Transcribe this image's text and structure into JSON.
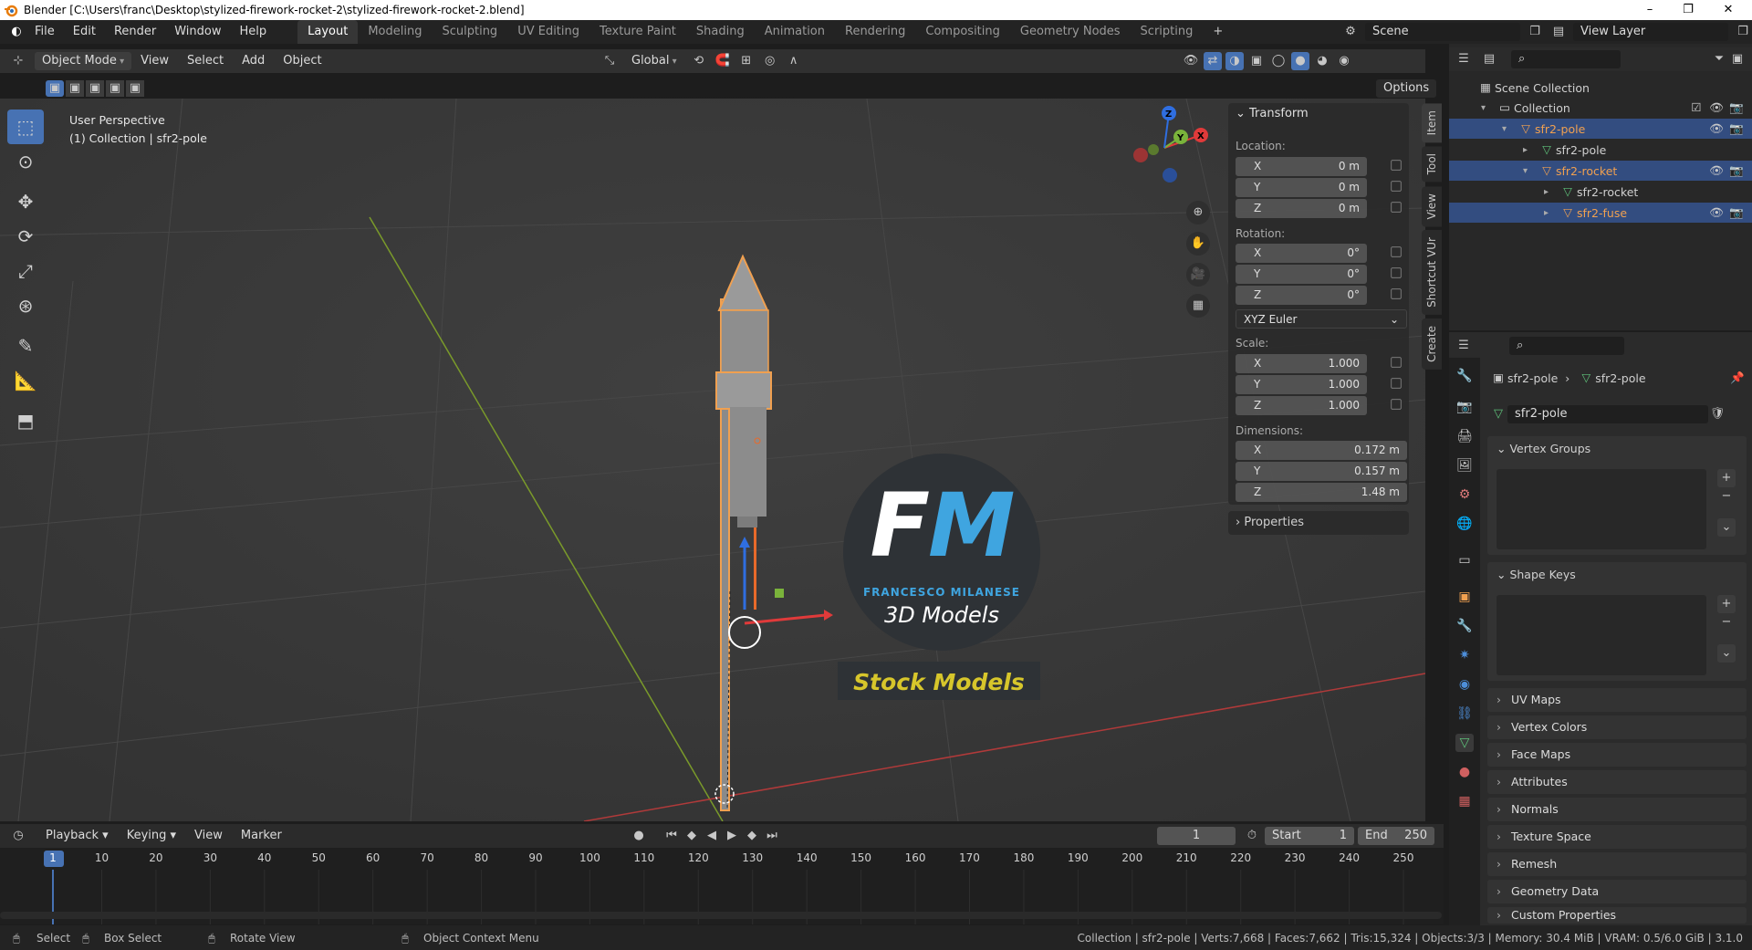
{
  "window": {
    "title": "Blender [C:\\Users\\franc\\Desktop\\stylized-firework-rocket-2\\stylized-firework-rocket-2.blend]",
    "minimize": "–",
    "maximize": "❐",
    "close": "✕"
  },
  "menu": [
    "File",
    "Edit",
    "Render",
    "Window",
    "Help"
  ],
  "workspaces": [
    "Layout",
    "Modeling",
    "Sculpting",
    "UV Editing",
    "Texture Paint",
    "Shading",
    "Animation",
    "Rendering",
    "Compositing",
    "Geometry Nodes",
    "Scripting"
  ],
  "active_workspace": "Layout",
  "add_workspace": "+",
  "scene_name": "Scene",
  "view_layer": "View Layer",
  "viewport_header": {
    "mode": "Object Mode",
    "view": "View",
    "select": "Select",
    "add": "Add",
    "object": "Object",
    "transform_orientation": "Global",
    "options": "Options"
  },
  "viewport_overlay": {
    "perspective": "User Perspective",
    "context": "(1) Collection | sfr2-pole"
  },
  "watermark": {
    "logo_letters": "FM",
    "author": "FRANCESCO MILANESE",
    "tagline": "3D Models",
    "stock": "Stock Models"
  },
  "gizmo_axes": [
    "X",
    "Y",
    "Z"
  ],
  "npanel": {
    "title": "Transform",
    "location_label": "Location:",
    "location": [
      {
        "axis": "X",
        "value": "0 m"
      },
      {
        "axis": "Y",
        "value": "0 m"
      },
      {
        "axis": "Z",
        "value": "0 m"
      }
    ],
    "rotation_label": "Rotation:",
    "rotation": [
      {
        "axis": "X",
        "value": "0°"
      },
      {
        "axis": "Y",
        "value": "0°"
      },
      {
        "axis": "Z",
        "value": "0°"
      }
    ],
    "rotation_mode": "XYZ Euler",
    "scale_label": "Scale:",
    "scale": [
      {
        "axis": "X",
        "value": "1.000"
      },
      {
        "axis": "Y",
        "value": "1.000"
      },
      {
        "axis": "Z",
        "value": "1.000"
      }
    ],
    "dimensions_label": "Dimensions:",
    "dimensions": [
      {
        "axis": "X",
        "value": "0.172 m"
      },
      {
        "axis": "Y",
        "value": "0.157 m"
      },
      {
        "axis": "Z",
        "value": "1.48 m"
      }
    ],
    "properties": "Properties"
  },
  "side_tabs": [
    "Item",
    "Tool",
    "View",
    "Shortcut VUr",
    "Create"
  ],
  "outliner": {
    "root": "Scene Collection",
    "items": [
      {
        "label": "Collection",
        "indent": 1,
        "selected": false,
        "color": "#d0d0d0"
      },
      {
        "label": "sfr2-pole",
        "indent": 2,
        "selected": true,
        "color": "#f0a050"
      },
      {
        "label": "sfr2-pole",
        "indent": 3,
        "selected": false,
        "color": "#d0d0d0"
      },
      {
        "label": "sfr2-rocket",
        "indent": 3,
        "selected": true,
        "color": "#f0a050"
      },
      {
        "label": "sfr2-rocket",
        "indent": 4,
        "selected": false,
        "color": "#d0d0d0"
      },
      {
        "label": "sfr2-fuse",
        "indent": 4,
        "selected": true,
        "color": "#f0a050"
      }
    ]
  },
  "properties_panel": {
    "breadcrumb_object": "sfr2-pole",
    "breadcrumb_data": "sfr2-pole",
    "mesh_name": "sfr2-pole",
    "sections_open": [
      "Vertex Groups",
      "Shape Keys"
    ],
    "sections_closed": [
      "UV Maps",
      "Vertex Colors",
      "Face Maps",
      "Attributes",
      "Normals",
      "Texture Space",
      "Remesh",
      "Geometry Data",
      "Custom Properties"
    ],
    "add": "+",
    "remove": "−"
  },
  "timeline": {
    "playback": "Playback",
    "keying": "Keying",
    "view": "View",
    "marker": "Marker",
    "current_frame": "1",
    "start_label": "Start",
    "start": "1",
    "end_label": "End",
    "end": "250",
    "ruler": [
      "1",
      "10",
      "20",
      "30",
      "40",
      "50",
      "60",
      "70",
      "80",
      "90",
      "100",
      "110",
      "120",
      "130",
      "140",
      "150",
      "160",
      "170",
      "180",
      "190",
      "200",
      "210",
      "220",
      "230",
      "240",
      "250"
    ]
  },
  "status": {
    "select": "Select",
    "box_select": "Box Select",
    "rotate_view": "Rotate View",
    "context_menu": "Object Context Menu",
    "stats": "Collection | sfr2-pole | Verts:7,668 | Faces:7,662 | Tris:15,324 | Objects:3/3 | Memory: 30.4 MiB | VRAM: 0.5/6.0 GiB | 3.1.0"
  },
  "colors": {
    "accent": "#4772b3",
    "selected_orange": "#f0a050",
    "grid_red": "#b03a3a",
    "grid_green": "#7a9a2a",
    "stock_yellow": "#d7c62b",
    "fm_blue": "#3fa5e0"
  }
}
